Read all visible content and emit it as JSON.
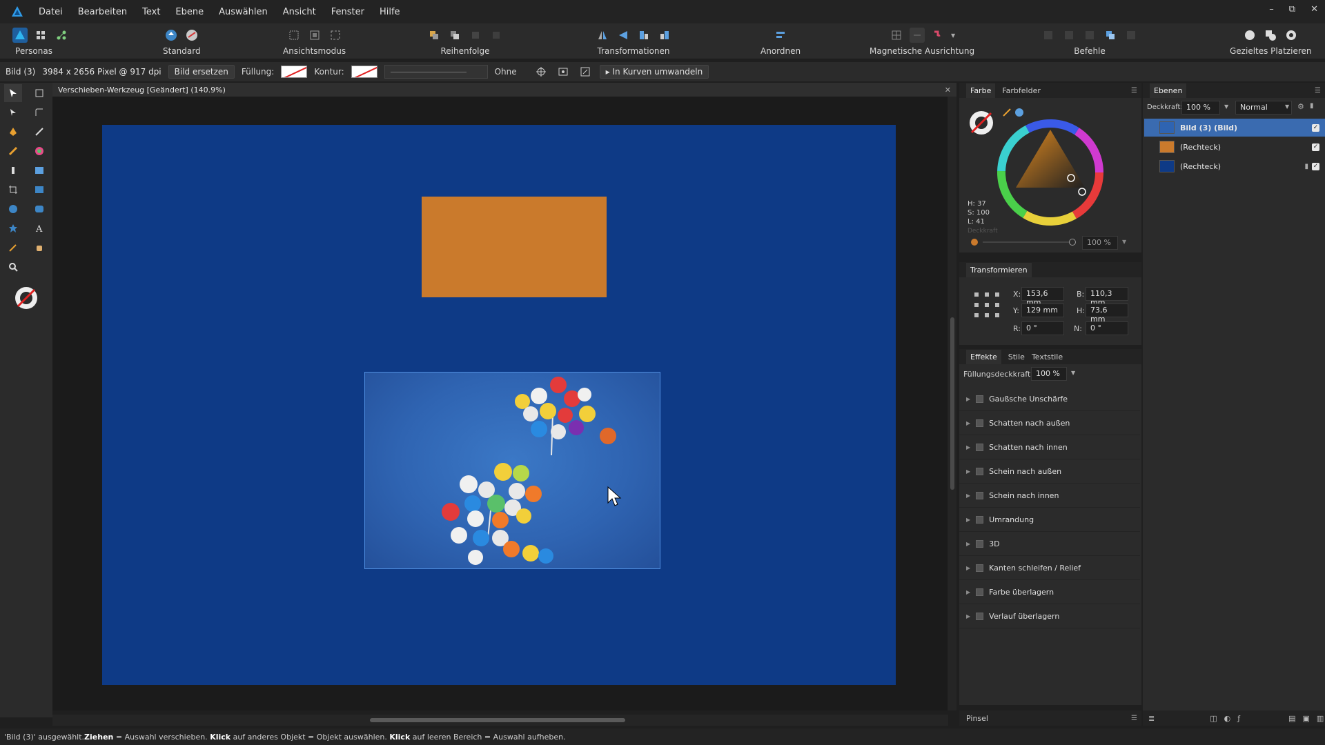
{
  "menubar": {
    "items": [
      "Datei",
      "Bearbeiten",
      "Text",
      "Ebene",
      "Auswählen",
      "Ansicht",
      "Fenster",
      "Hilfe"
    ],
    "window_controls": [
      "–",
      "⧉",
      "✕"
    ]
  },
  "toolbar": {
    "groups": [
      {
        "label": "Personas"
      },
      {
        "label": "Standard"
      },
      {
        "label": "Ansichtsmodus"
      },
      {
        "label": "Reihenfolge"
      },
      {
        "label": "Transformationen"
      },
      {
        "label": "Anordnen"
      },
      {
        "label": "Magnetische Ausrichtung"
      },
      {
        "label": "Befehle"
      },
      {
        "label": "Gezieltes Platzieren"
      }
    ]
  },
  "context": {
    "selection": "Bild (3)",
    "info": "3984 x 2656 Pixel @ 917 dpi",
    "replace_button": "Bild ersetzen",
    "fill_label": "Füllung:",
    "stroke_label": "Kontur:",
    "stroke_width": "Ohne",
    "convert_button": "In Kurven umwandeln"
  },
  "document": {
    "title": "Verschieben-Werkzeug [Geändert] (140.9%)",
    "close": "✕",
    "colors": {
      "artboard": "#0e3a86",
      "orange_rect": "#ca7a2c"
    }
  },
  "color_panel": {
    "tabs": [
      "Farbe",
      "Farbfelder"
    ],
    "h": "H: 37",
    "s": "S: 100",
    "l": "L: 41",
    "opacity_label": "Deckkraft",
    "opacity": "100 %"
  },
  "transform_panel": {
    "title": "Transformieren",
    "x_label": "X:",
    "x": "153,6 mm",
    "y_label": "Y:",
    "y": "129 mm",
    "b_label": "B:",
    "b": "110,3 mm",
    "h_label": "H:",
    "h": "73,6 mm",
    "r_label": "R:",
    "r": "0 °",
    "n_label": "N:",
    "n": "0 °"
  },
  "effects_panel": {
    "tabs": [
      "Effekte",
      "Stile",
      "Textstile"
    ],
    "fill_opacity_label": "Füllungsdeckkraft:",
    "fill_opacity": "100 %",
    "effects": [
      "Gaußsche Unschärfe",
      "Schatten nach außen",
      "Schatten nach innen",
      "Schein nach außen",
      "Schein nach innen",
      "Umrandung",
      "3D",
      "Kanten schleifen / Relief",
      "Farbe überlagern",
      "Verlauf überlagern"
    ]
  },
  "brush_panel": {
    "title": "Pinsel"
  },
  "layers_panel": {
    "title": "Ebenen",
    "opacity_label": "Deckkraft:",
    "opacity": "100 %",
    "blend_mode": "Normal",
    "layers": [
      {
        "name": "Bild (3) (Bild)",
        "selected": true,
        "color": "#2f64b2"
      },
      {
        "name": "(Rechteck)",
        "selected": false,
        "color": "#ca7a2c"
      },
      {
        "name": "(Rechteck)",
        "selected": false,
        "color": "#0e3a86"
      }
    ]
  },
  "status": {
    "t1": "'Bild (3)' ausgewählt. ",
    "b1": "Ziehen",
    "t2": " = Auswahl verschieben. ",
    "b2": "Klick",
    "t3": " auf anderes Objekt = Objekt auswählen. ",
    "b3": "Klick",
    "t4": " auf leeren Bereich = Auswahl aufheben."
  }
}
